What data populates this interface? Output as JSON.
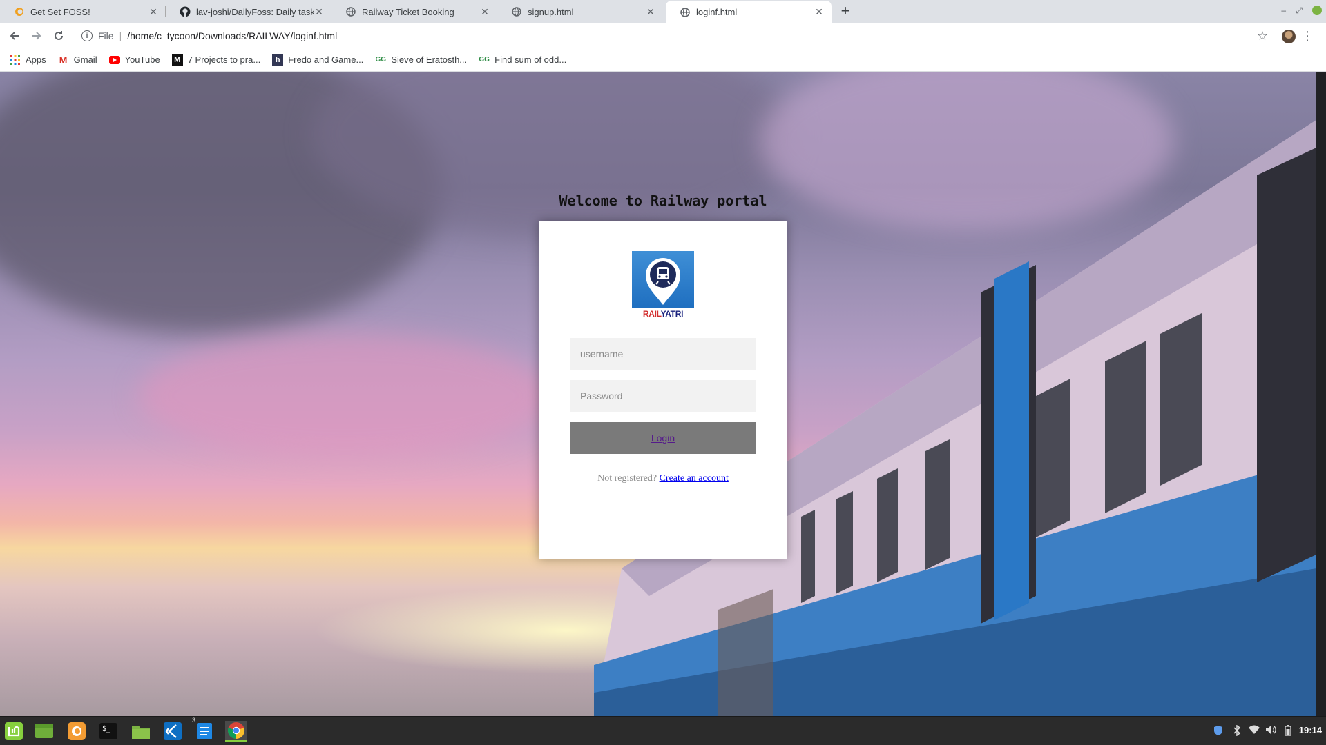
{
  "browser": {
    "tabs": [
      {
        "title": "Get Set FOSS!",
        "icon": "foss-favicon"
      },
      {
        "title": "lav-joshi/DailyFoss: Daily task",
        "icon": "github-icon"
      },
      {
        "title": "Railway Ticket Booking",
        "icon": "globe-icon"
      },
      {
        "title": "signup.html",
        "icon": "globe-icon"
      },
      {
        "title": "loginf.html",
        "icon": "globe-icon",
        "active": true
      }
    ],
    "address": {
      "scheme": "File",
      "url": "/home/c_tycoon/Downloads/RAILWAY/loginf.html"
    },
    "bookmarks": [
      {
        "label": "Apps",
        "icon": "apps-grid-icon"
      },
      {
        "label": "Gmail",
        "icon": "gmail-icon"
      },
      {
        "label": "YouTube",
        "icon": "youtube-icon"
      },
      {
        "label": "7 Projects to pra...",
        "icon": "medium-icon"
      },
      {
        "label": "Fredo and Game...",
        "icon": "hackerearth-icon"
      },
      {
        "label": "Sieve of Eratosth...",
        "icon": "gfg-icon"
      },
      {
        "label": "Find sum of odd...",
        "icon": "gfg-icon"
      }
    ]
  },
  "page": {
    "welcome": "Welcome to Railway portal",
    "logo": {
      "brand_rail": "RAIL",
      "brand_yatri": "YATRI"
    },
    "username_placeholder": "username",
    "password_placeholder": "Password",
    "login_label": "Login",
    "register_prompt": "Not registered?",
    "register_link": "Create an account"
  },
  "taskbar": {
    "apps": [
      "mint-menu-icon",
      "show-desktop-icon",
      "firefox-icon",
      "terminal-icon",
      "files-icon",
      "vscode-icon",
      "text-editor-icon",
      "chrome-icon"
    ],
    "text_editor_badge": "3",
    "clock": "19:14"
  },
  "colors": {
    "accent_blue": "#1f6fc0",
    "login_button": "#7a7a7a",
    "link": "#0000ee",
    "taskbar": "#2b2b2b"
  }
}
